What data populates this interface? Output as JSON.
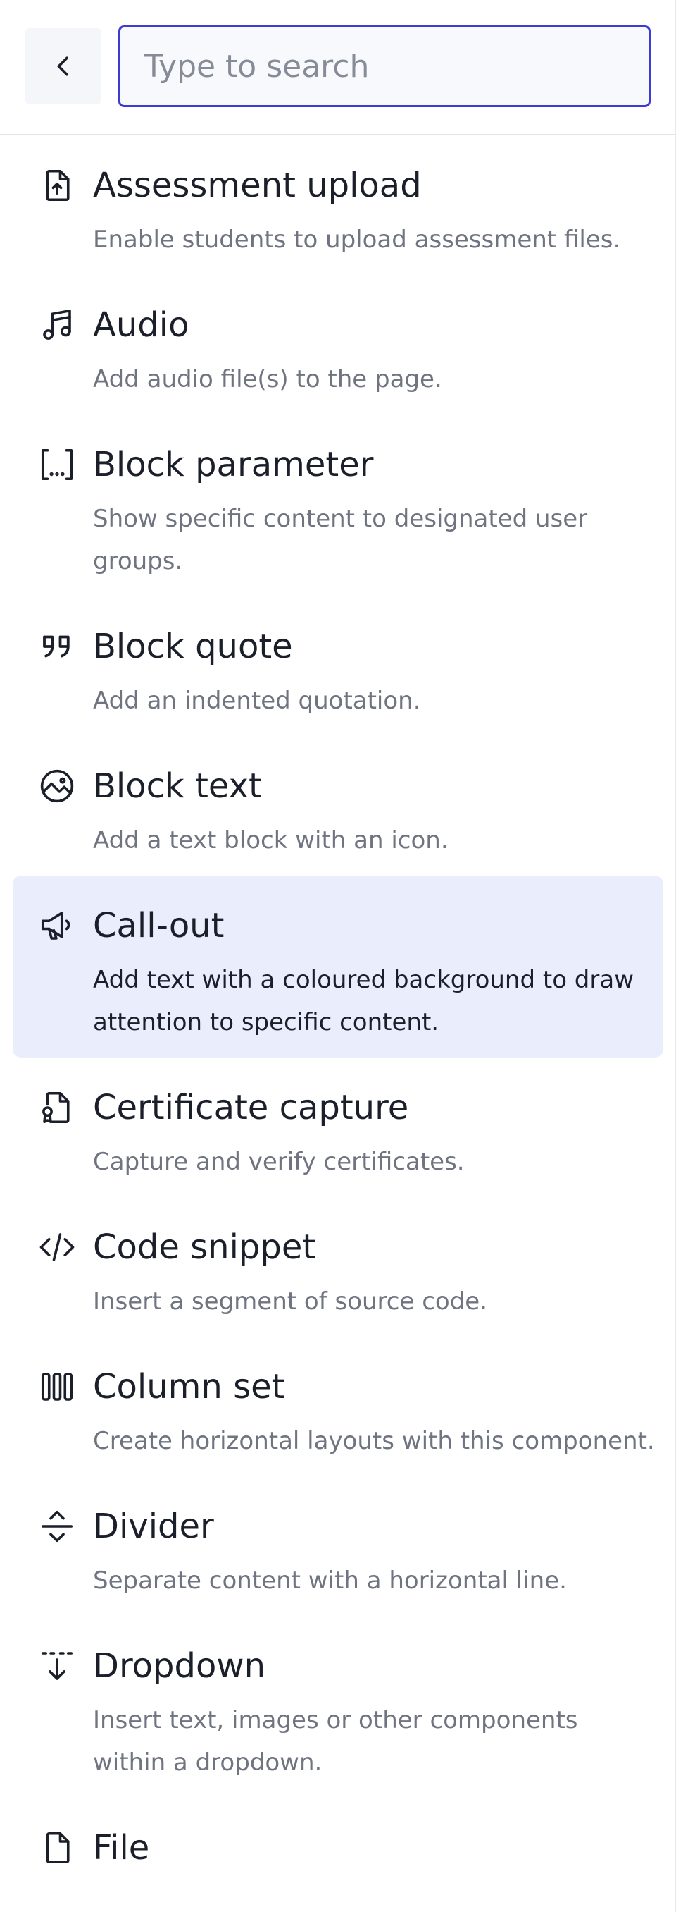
{
  "search": {
    "placeholder": "Type to search",
    "value": ""
  },
  "back_label": "Back",
  "items": [
    {
      "title": "Assessment upload",
      "description": "Enable students to upload assessment files.",
      "icon": "file-upload-icon",
      "selected": false
    },
    {
      "title": "Audio",
      "description": "Add audio file(s) to the page.",
      "icon": "music-note-icon",
      "selected": false
    },
    {
      "title": "Block parameter",
      "description": "Show specific content to designated user groups.",
      "icon": "bracket-ellipsis-icon",
      "selected": false
    },
    {
      "title": "Block quote",
      "description": "Add an indented quotation.",
      "icon": "quote-icon",
      "selected": false
    },
    {
      "title": "Block text",
      "description": "Add a text block with an icon.",
      "icon": "image-circle-icon",
      "selected": false
    },
    {
      "title": "Call-out",
      "description": "Add text with a coloured background to draw attention to specific content.",
      "icon": "megaphone-icon",
      "selected": true
    },
    {
      "title": "Certificate capture",
      "description": "Capture and verify certificates.",
      "icon": "certificate-icon",
      "selected": false
    },
    {
      "title": "Code snippet",
      "description": "Insert a segment of source code.",
      "icon": "code-icon",
      "selected": false
    },
    {
      "title": "Column set",
      "description": "Create horizontal layouts with this component.",
      "icon": "columns-icon",
      "selected": false
    },
    {
      "title": "Divider",
      "description": "Separate content with a horizontal line.",
      "icon": "divider-icon",
      "selected": false
    },
    {
      "title": "Dropdown",
      "description": "Insert text, images or other components within a dropdown.",
      "icon": "dropdown-arrow-icon",
      "selected": false
    },
    {
      "title": "File",
      "description": "",
      "icon": "file-icon",
      "selected": false
    }
  ]
}
